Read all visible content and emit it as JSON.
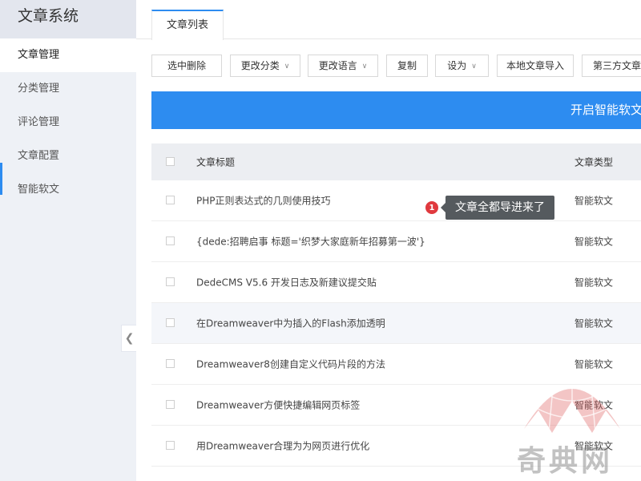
{
  "sidebar": {
    "brand": "文章系统",
    "items": [
      {
        "label": "文章管理",
        "active": true
      },
      {
        "label": "分类管理"
      },
      {
        "label": "评论管理"
      },
      {
        "label": "文章配置"
      },
      {
        "label": "智能软文"
      }
    ]
  },
  "tabs": {
    "active": "文章列表"
  },
  "toolbar": {
    "delete_selected": "选中删除",
    "change_category": "更改分类",
    "change_language": "更改语言",
    "copy": "复制",
    "set_as": "设为",
    "local_import": "本地文章导入",
    "third_party_import": "第三方文章导入"
  },
  "banner": {
    "label": "开启智能软文"
  },
  "table": {
    "headers": {
      "title": "文章标题",
      "type": "文章类型"
    },
    "rows": [
      {
        "title": "PHP正则表达式的几则使用技巧",
        "type": "智能软文"
      },
      {
        "title": "{dede:招聘启事 标题='织梦大家庭新年招募第一波'}",
        "type": "智能软文"
      },
      {
        "title": "DedeCMS V5.6 开发日志及新建议提交贴",
        "type": "智能软文"
      },
      {
        "title": "在Dreamweaver中为插入的Flash添加透明",
        "type": "智能软文"
      },
      {
        "title": "Dreamweaver8创建自定义代码片段的方法",
        "type": "智能软文"
      },
      {
        "title": "Dreamweaver方便快捷编辑网页标签",
        "type": "智能软文"
      },
      {
        "title": "用Dreamweaver合理为为网页进行优化",
        "type": "智能软文"
      }
    ]
  },
  "annotation": {
    "number": "1",
    "text": "文章全都导进来了"
  },
  "watermark": {
    "text": "奇典网"
  },
  "colors": {
    "accent": "#2d8cf0",
    "badge": "#e0393e"
  }
}
